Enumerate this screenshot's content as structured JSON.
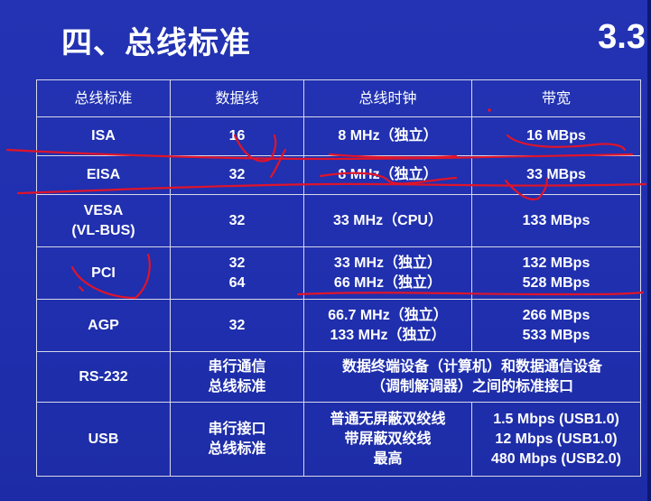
{
  "slide": {
    "title": "四、总线标准",
    "page_number": "3.3"
  },
  "table": {
    "headers": [
      "总线标准",
      "数据线",
      "总线时钟",
      "带宽"
    ],
    "rows": [
      {
        "bus": [
          "ISA"
        ],
        "data": [
          "16"
        ],
        "clock": [
          "8 MHz（独立）"
        ],
        "bandwidth": [
          "16 MBps"
        ]
      },
      {
        "bus": [
          "EISA"
        ],
        "data": [
          "32"
        ],
        "clock": [
          "8 MHz（独立）"
        ],
        "bandwidth": [
          "33 MBps"
        ]
      },
      {
        "bus": [
          "VESA",
          "(VL-BUS)"
        ],
        "data": [
          "32"
        ],
        "clock": [
          "33 MHz（CPU）"
        ],
        "bandwidth": [
          "133 MBps"
        ]
      },
      {
        "bus": [
          "PCI"
        ],
        "data": [
          "32",
          "64"
        ],
        "clock": [
          "33 MHz（独立）",
          "66 MHz（独立）"
        ],
        "bandwidth": [
          "132 MBps",
          "528 MBps"
        ]
      },
      {
        "bus": [
          "AGP"
        ],
        "data": [
          "32"
        ],
        "clock": [
          "66.7 MHz（独立）",
          "133 MHz（独立）"
        ],
        "bandwidth": [
          "266 MBps",
          "533 MBps"
        ]
      },
      {
        "bus": [
          "RS-232"
        ],
        "data": [
          "串行通信",
          "总线标准"
        ],
        "merged": [
          "数据终端设备（计算机）和数据通信设备",
          "（调制解调器）之间的标准接口"
        ]
      },
      {
        "bus": [
          "USB"
        ],
        "data": [
          "串行接口",
          "总线标准"
        ],
        "clock": [
          "普通无屏蔽双绞线",
          "带屏蔽双绞线",
          "最高"
        ],
        "bandwidth": [
          "1.5 Mbps (USB1.0)",
          "12 Mbps (USB1.0)",
          "480 Mbps (USB2.0)"
        ]
      }
    ]
  },
  "colors": {
    "background": "#1f2fae",
    "text": "#ffffff",
    "grid": "#d8d8e8",
    "annotation": "#e0142a"
  }
}
